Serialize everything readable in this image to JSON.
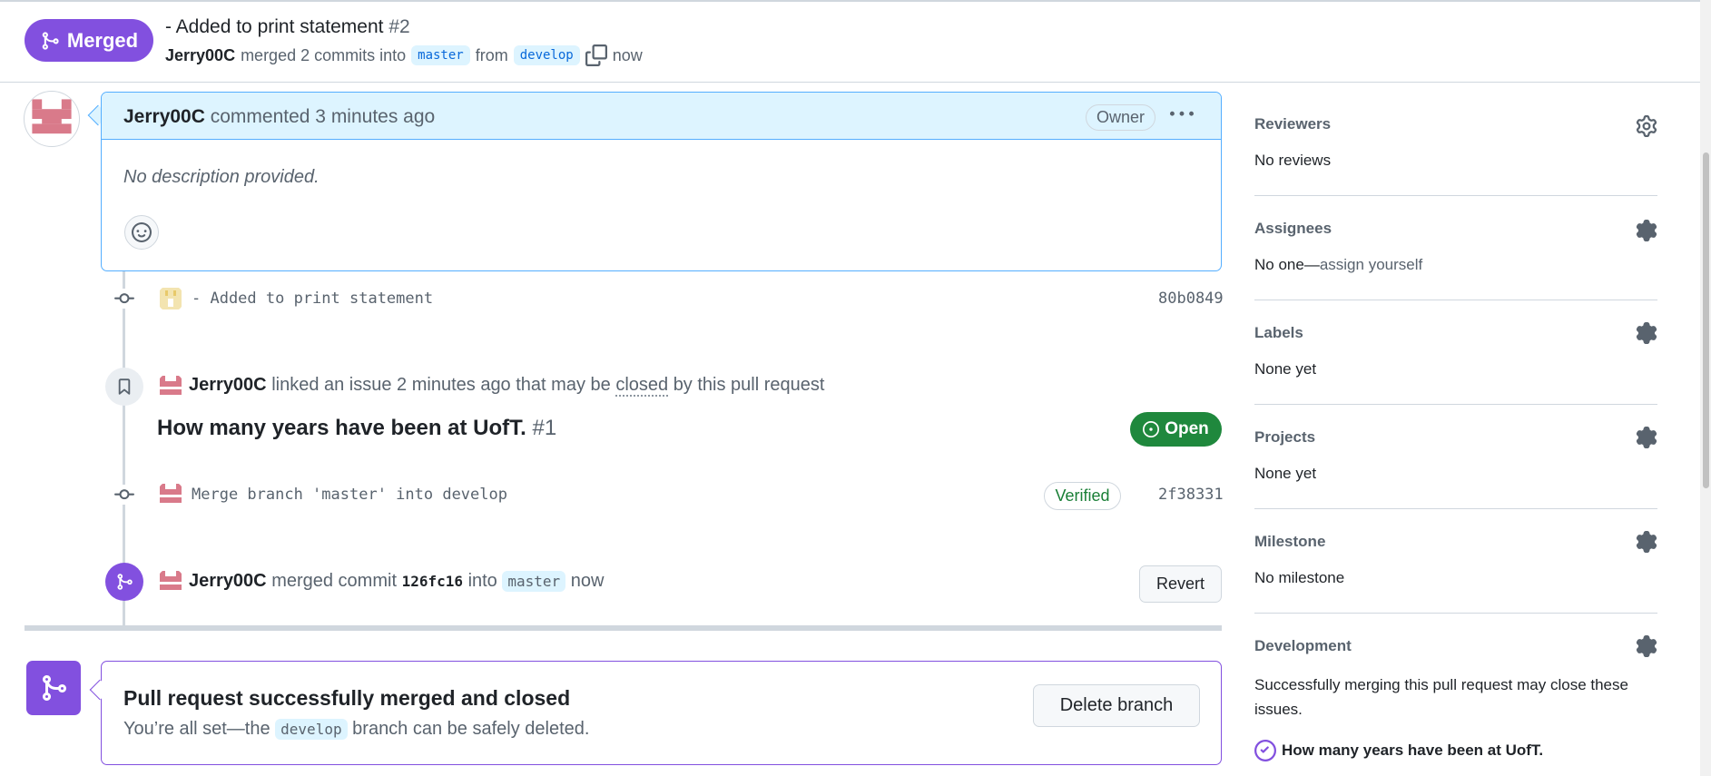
{
  "header": {
    "status_label": "Merged",
    "title": "- Added to print statement",
    "number": "#2",
    "author": "Jerry00C",
    "merge_text": "merged 2 commits into",
    "base_branch": "master",
    "from_text": "from",
    "head_branch": "develop",
    "time": "now"
  },
  "comment": {
    "author": "Jerry00C",
    "action": "commented 3 minutes ago",
    "role_badge": "Owner",
    "body": "No description provided."
  },
  "timeline": {
    "commit1": {
      "message": "- Added to print statement",
      "sha": "80b0849"
    },
    "linked_issue_event": {
      "author": "Jerry00C",
      "text_before": "linked an issue 2 minutes ago that may be",
      "closed_word": "closed",
      "text_after": "by this pull request"
    },
    "issue": {
      "title": "How many years have been at UofT.",
      "number": "#1",
      "state": "Open"
    },
    "commit2": {
      "message": "Merge branch 'master' into develop",
      "verified": "Verified",
      "sha": "2f38331"
    },
    "merge_event": {
      "author": "Jerry00C",
      "text1": "merged commit",
      "commit": "126fc16",
      "text2": "into",
      "branch": "master",
      "time": "now",
      "revert_label": "Revert"
    }
  },
  "merged_box": {
    "title": "Pull request successfully merged and closed",
    "sub_before": "You’re all set—the",
    "branch": "develop",
    "sub_after": "branch can be safely deleted.",
    "delete_label": "Delete branch"
  },
  "sidebar": {
    "reviewers": {
      "heading": "Reviewers",
      "value": "No reviews"
    },
    "assignees": {
      "heading": "Assignees",
      "value": "No one—",
      "link": "assign yourself"
    },
    "labels": {
      "heading": "Labels",
      "value": "None yet"
    },
    "projects": {
      "heading": "Projects",
      "value": "None yet"
    },
    "milestone": {
      "heading": "Milestone",
      "value": "No milestone"
    },
    "development": {
      "heading": "Development",
      "value": "Successfully merging this pull request may close these issues.",
      "issue": "How many years have been at UofT."
    }
  },
  "colors": {
    "merged_purple": "#8250df",
    "open_green": "#1f883d",
    "accent_blue": "#0969da",
    "comment_header_bg": "#ddf4ff",
    "border": "#d0d7de"
  },
  "icons": [
    "git-merge-icon",
    "copy-icon",
    "kebab-horizontal-icon",
    "smiley-icon",
    "git-commit-icon",
    "bookmark-icon",
    "issue-opened-icon",
    "gear-icon",
    "check-circle-icon",
    "avatar-identicon"
  ]
}
